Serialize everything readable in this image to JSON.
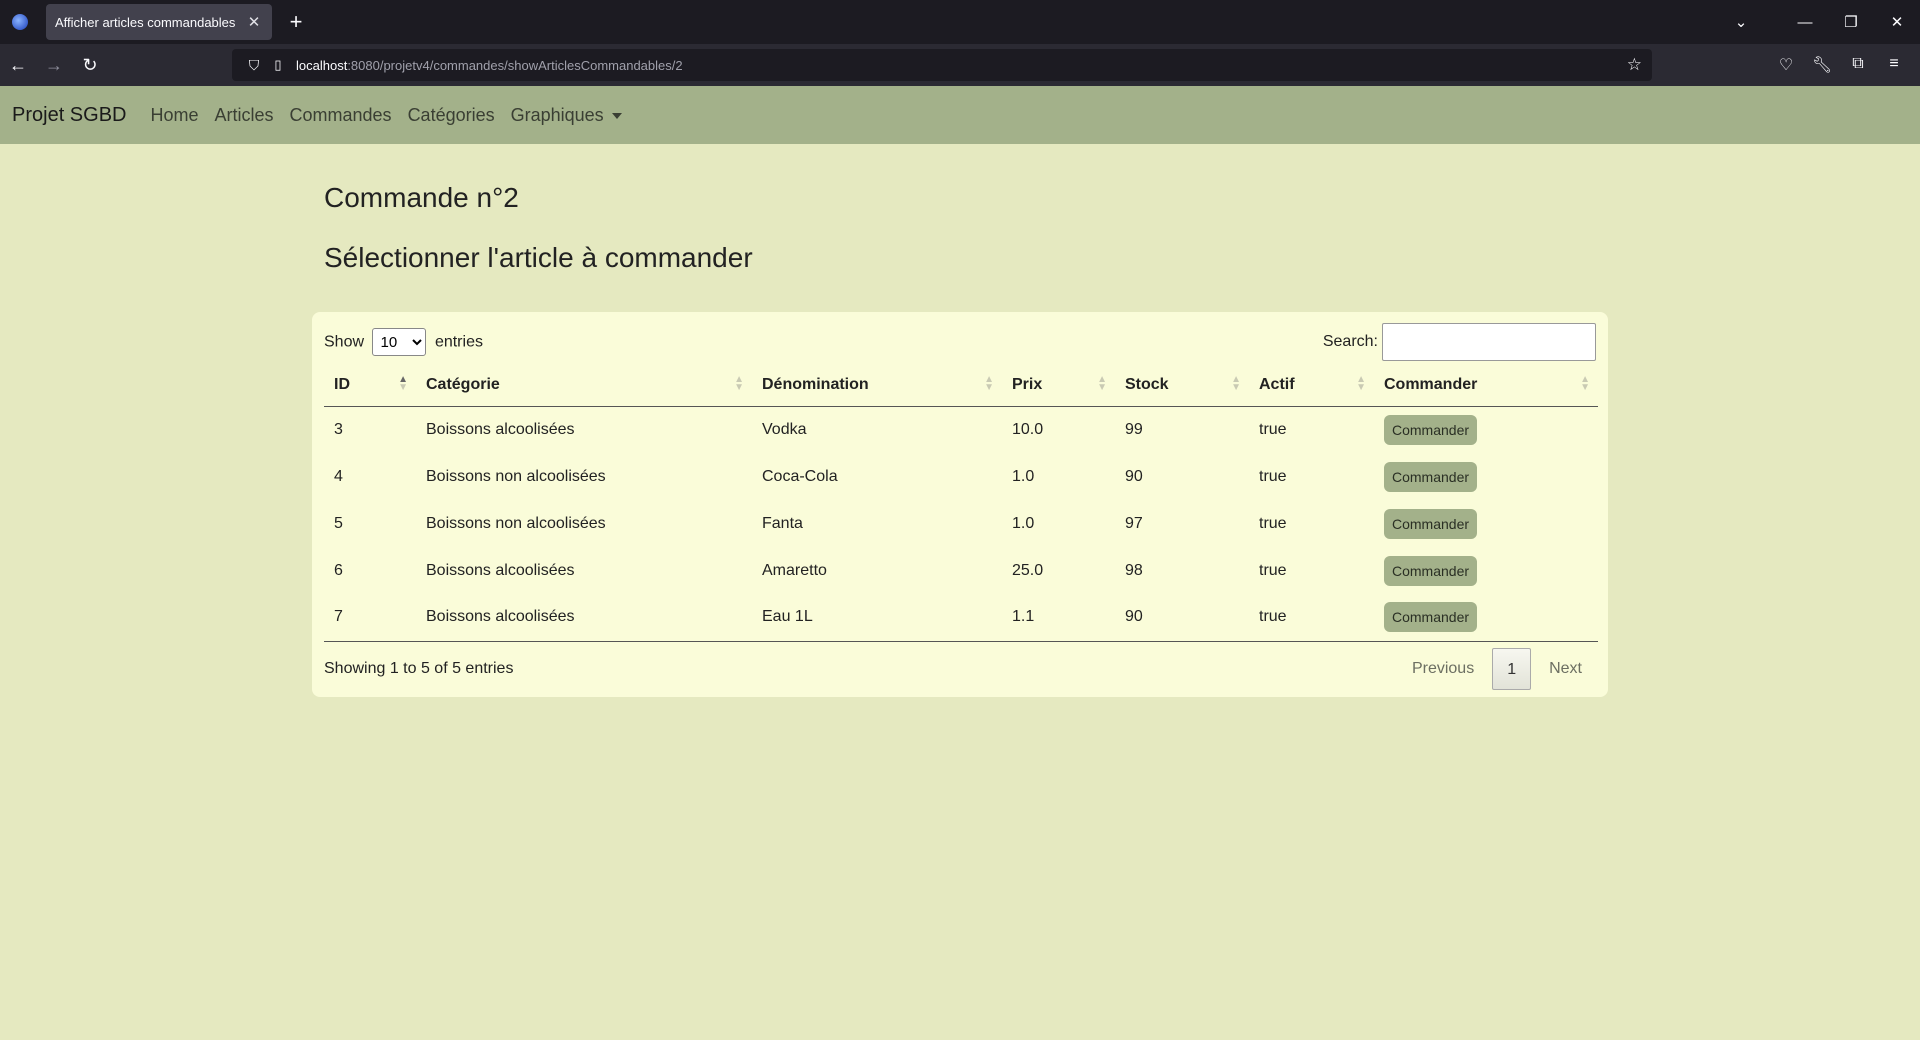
{
  "browser": {
    "tab_title": "Afficher articles commandables",
    "url_host": "localhost",
    "url_path": ":8080/projetv4/commandes/showArticlesCommandables/2"
  },
  "nav": {
    "brand": "Projet SGBD",
    "links": [
      "Home",
      "Articles",
      "Commandes",
      "Catégories",
      "Graphiques"
    ]
  },
  "page": {
    "title": "Commande n°2",
    "subtitle": "Sélectionner l'article à commander"
  },
  "datatable": {
    "show_label": "Show",
    "entries_label": "entries",
    "length_value": "10",
    "search_label": "Search:",
    "search_value": "",
    "columns": [
      "ID",
      "Catégorie",
      "Dénomination",
      "Prix",
      "Stock",
      "Actif",
      "Commander"
    ],
    "rows": [
      {
        "id": "3",
        "categorie": "Boissons alcoolisées",
        "denomination": "Vodka",
        "prix": "10.0",
        "stock": "99",
        "actif": "true",
        "action": "Commander"
      },
      {
        "id": "4",
        "categorie": "Boissons non alcoolisées",
        "denomination": "Coca-Cola",
        "prix": "1.0",
        "stock": "90",
        "actif": "true",
        "action": "Commander"
      },
      {
        "id": "5",
        "categorie": "Boissons non alcoolisées",
        "denomination": "Fanta",
        "prix": "1.0",
        "stock": "97",
        "actif": "true",
        "action": "Commander"
      },
      {
        "id": "6",
        "categorie": "Boissons alcoolisées",
        "denomination": "Amaretto",
        "prix": "25.0",
        "stock": "98",
        "actif": "true",
        "action": "Commander"
      },
      {
        "id": "7",
        "categorie": "Boissons alcoolisées",
        "denomination": "Eau 1L",
        "prix": "1.1",
        "stock": "90",
        "actif": "true",
        "action": "Commander"
      }
    ],
    "info": "Showing 1 to 5 of 5 entries",
    "pager": {
      "previous": "Previous",
      "current": "1",
      "next": "Next"
    }
  }
}
